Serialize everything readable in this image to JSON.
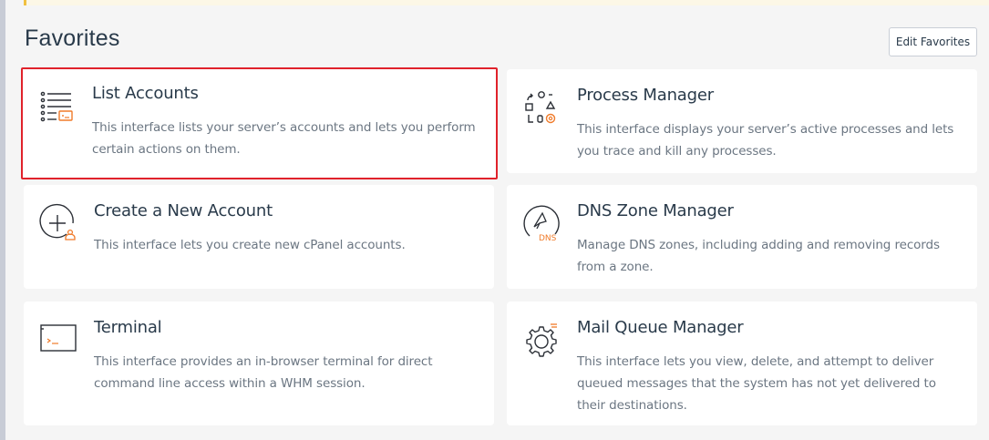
{
  "section": {
    "title": "Favorites",
    "edit_label": "Edit Favorites"
  },
  "colors": {
    "accent": "#f07b2a",
    "highlight": "#e0222b",
    "title_text": "#293a4a",
    "desc_text": "#6b7682"
  },
  "cards": [
    {
      "title": "List Accounts",
      "description": "This interface lists your server’s accounts and lets you perform certain actions on them.",
      "icon": "list-accounts-icon",
      "highlighted": true
    },
    {
      "title": "Process Manager",
      "description": "This interface displays your server’s active processes and lets you trace and kill any processes.",
      "icon": "process-manager-icon",
      "highlighted": false
    },
    {
      "title": "Create a New Account",
      "description": "This interface lets you create new cPanel accounts.",
      "icon": "create-account-icon",
      "highlighted": false
    },
    {
      "title": "DNS Zone Manager",
      "description": "Manage DNS zones, including adding and removing records from a zone.",
      "icon": "dns-zone-icon",
      "icon_text": "DNS",
      "highlighted": false
    },
    {
      "title": "Terminal",
      "description": "This interface provides an in-browser terminal for direct command line access within a WHM session.",
      "icon": "terminal-icon",
      "highlighted": false
    },
    {
      "title": "Mail Queue Manager",
      "description": "This interface lets you view, delete, and attempt to deliver queued messages that the system has not yet delivered to their destinations.",
      "icon": "mail-queue-gear-icon",
      "highlighted": false
    }
  ]
}
